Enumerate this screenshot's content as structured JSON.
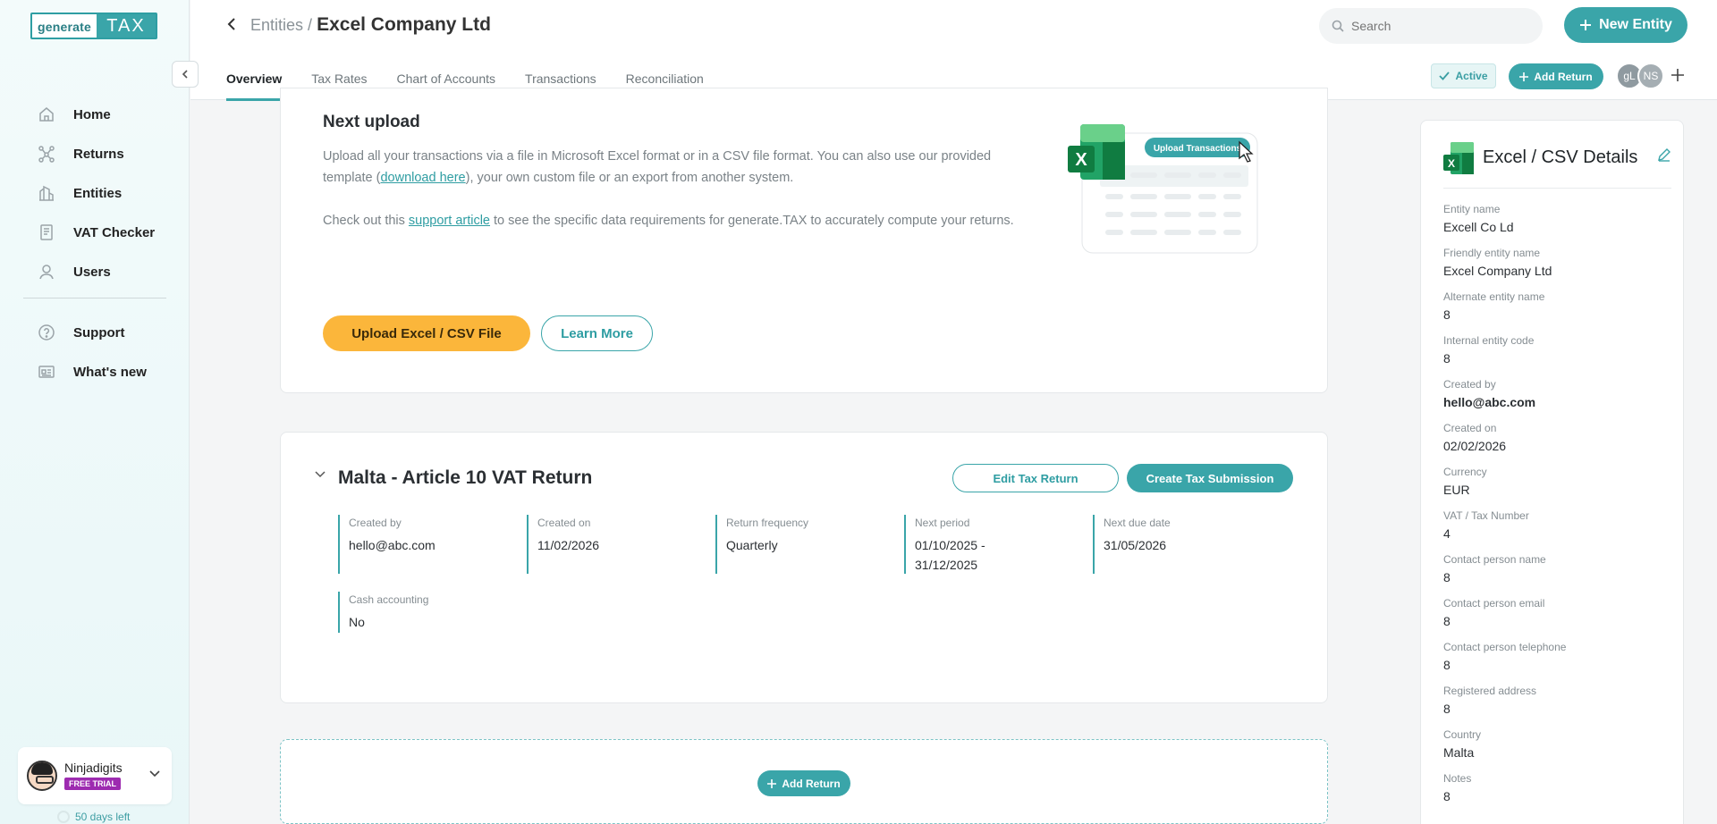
{
  "sidebar": {
    "logo_left": "generate",
    "logo_right": "TAX",
    "items": [
      {
        "label": "Home",
        "icon": "home-icon"
      },
      {
        "label": "Returns",
        "icon": "returns-icon"
      },
      {
        "label": "Entities",
        "icon": "entities-icon"
      },
      {
        "label": "VAT Checker",
        "icon": "vat-checker-icon"
      },
      {
        "label": "Users",
        "icon": "users-icon"
      }
    ],
    "items2": [
      {
        "label": "Support",
        "icon": "support-icon"
      },
      {
        "label": "What's new",
        "icon": "whats-new-icon"
      }
    ],
    "user": {
      "name": "Ninjadigits",
      "badge": "FREE TRIAL",
      "days_left": "50 days left"
    }
  },
  "header": {
    "breadcrumb_parent": "Entities",
    "breadcrumb_sep": "/",
    "breadcrumb_current": "Excel Company Ltd",
    "search_placeholder": "Search",
    "new_entity": "New Entity",
    "tabs": [
      "Overview",
      "Tax Rates",
      "Chart of Accounts",
      "Transactions",
      "Reconciliation"
    ],
    "status": "Active",
    "add_return": "Add Return",
    "avatars": [
      "gL",
      "NS"
    ]
  },
  "upload": {
    "title": "Next upload",
    "p1_a": "Upload all your transactions via a file in Microsoft Excel format or in a CSV file format. You can also use our provided template (",
    "p1_link": "download here",
    "p1_b": "), your own custom file or an export from another system.",
    "p2_a": "Check out this ",
    "p2_link": "support article",
    "p2_b": " to see the specific data requirements for generate.TAX to accurately compute your returns.",
    "upload_btn": "Upload Excel / CSV File",
    "learn_btn": "Learn More",
    "illus_label": "Upload Transactions",
    "illus_x": "X"
  },
  "return_card": {
    "title": "Malta - Article 10 VAT Return",
    "edit_btn": "Edit Tax Return",
    "create_btn": "Create Tax Submission",
    "fields": [
      {
        "label": "Created by",
        "value": "hello@abc.com"
      },
      {
        "label": "Created on",
        "value": "11/02/2026"
      },
      {
        "label": "Return frequency",
        "value": "Quarterly"
      },
      {
        "label": "Next period",
        "value": "01/10/2025 - 31/12/2025"
      },
      {
        "label": "Next due date",
        "value": "31/05/2026"
      },
      {
        "label": "Cash accounting",
        "value": "No"
      }
    ]
  },
  "add_return_mid": "Add Return",
  "details": {
    "title": "Excel / CSV Details",
    "rows": [
      {
        "label": "Entity name",
        "value": "Excell Co Ld"
      },
      {
        "label": "Friendly entity name",
        "value": "Excel Company Ltd"
      },
      {
        "label": "Alternate entity name",
        "value": "8"
      },
      {
        "label": "Internal entity code",
        "value": "8"
      },
      {
        "label": "Created by",
        "value": "hello@abc.com"
      },
      {
        "label": "Created on",
        "value": "02/02/2026"
      },
      {
        "label": "Currency",
        "value": "EUR"
      },
      {
        "label": "VAT / Tax Number",
        "value": "4"
      },
      {
        "label": "Contact person name",
        "value": "8"
      },
      {
        "label": "Contact person email",
        "value": "8"
      },
      {
        "label": "Contact person telephone",
        "value": "8"
      },
      {
        "label": "Registered address",
        "value": "8"
      },
      {
        "label": "Country",
        "value": "Malta"
      },
      {
        "label": "Notes",
        "value": "8"
      }
    ]
  },
  "colors": {
    "accent": "#3aa5a9",
    "upload_button": "#fbb63b",
    "trial_badge": "#9d2bb0"
  }
}
